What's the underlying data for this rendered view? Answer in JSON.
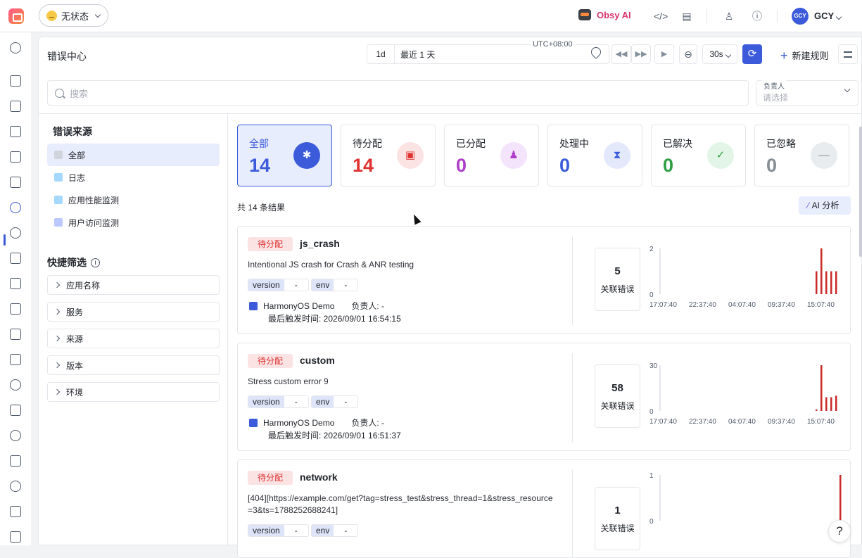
{
  "topbar": {
    "status_label": "无状态",
    "obsy_label": "Obsy AI",
    "user_initials": "GCY",
    "user_name": "GCY"
  },
  "header": {
    "title": "错误中心",
    "range_short": "1d",
    "range_label": "最近 1 天",
    "timezone": "UTC+08:00",
    "refresh_interval": "30s",
    "new_rule_label": "新建规则"
  },
  "search": {
    "placeholder": "搜索"
  },
  "owner_filter": {
    "label": "负责人",
    "placeholder": "请选择"
  },
  "sources": {
    "title": "错误来源",
    "items": [
      {
        "label": "全部",
        "color": "#a0a7b4"
      },
      {
        "label": "日志",
        "color": "#4dabf7"
      },
      {
        "label": "应用性能监测",
        "color": "#4dabf7"
      },
      {
        "label": "用户访问监测",
        "color": "#5c7cfa"
      }
    ]
  },
  "quick_filter": {
    "title": "快捷筛选",
    "items": [
      "应用名称",
      "服务",
      "来源",
      "版本",
      "环境"
    ]
  },
  "stats": [
    {
      "label": "全部",
      "value": "14",
      "color": "#3b5bdb",
      "icon_bg": "#3b5bdb"
    },
    {
      "label": "待分配",
      "value": "14",
      "color": "#e03131",
      "icon_bg": "#fbe3e3"
    },
    {
      "label": "已分配",
      "value": "0",
      "color": "#ae3ec9",
      "icon_bg": "#f3e3fb"
    },
    {
      "label": "处理中",
      "value": "0",
      "color": "#3b5bdb",
      "icon_bg": "#e3e8fb"
    },
    {
      "label": "已解决",
      "value": "0",
      "color": "#2f9e44",
      "icon_bg": "#e3f5e6"
    },
    {
      "label": "已忽略",
      "value": "0",
      "color": "#868e96",
      "icon_bg": "#e9ecef"
    }
  ],
  "result_text": "共 14 条结果",
  "ai_button": "AI 分析",
  "errors": [
    {
      "status": "待分配",
      "name": "js_crash",
      "message": "Intentional JS crash for Crash & ANR testing",
      "tags": [
        {
          "k": "version",
          "v": "-"
        },
        {
          "k": "env",
          "v": "-"
        }
      ],
      "app": "HarmonyOS Demo",
      "owner": "负责人: -",
      "last_seen": "最后触发时间: 2026/09/01 16:54:15",
      "related_count": "5",
      "related_label": "关联错误",
      "ymax": "2",
      "ymin": "0",
      "x_ticks": [
        "17:07:40",
        "22:37:40",
        "04:07:40",
        "09:37:40",
        "15:07:40"
      ],
      "bars": [
        1,
        2,
        1,
        1,
        1
      ]
    },
    {
      "status": "待分配",
      "name": "custom",
      "message": "Stress custom error 9",
      "tags": [
        {
          "k": "version",
          "v": "-"
        },
        {
          "k": "env",
          "v": "-"
        }
      ],
      "app": "HarmonyOS Demo",
      "owner": "负责人: -",
      "last_seen": "最后触发时间: 2026/09/01 16:51:37",
      "related_count": "58",
      "related_label": "关联错误",
      "ymax": "30",
      "ymin": "0",
      "x_ticks": [
        "17:07:40",
        "22:37:40",
        "04:07:40",
        "09:37:40",
        "15:07:40"
      ],
      "bars": [
        1,
        30,
        9,
        9,
        10
      ]
    },
    {
      "status": "待分配",
      "name": "network",
      "message": "[404][https://example.com/get?tag=stress_test&stress_thread=1&stress_resource=3&ts=1788252688241]",
      "tags": [
        {
          "k": "version",
          "v": "-"
        },
        {
          "k": "env",
          "v": "-"
        }
      ],
      "related_count": "1",
      "related_label": "关联错误",
      "ymax": "1",
      "ymin": "0",
      "bars": [
        1
      ]
    }
  ],
  "help_label": "?"
}
